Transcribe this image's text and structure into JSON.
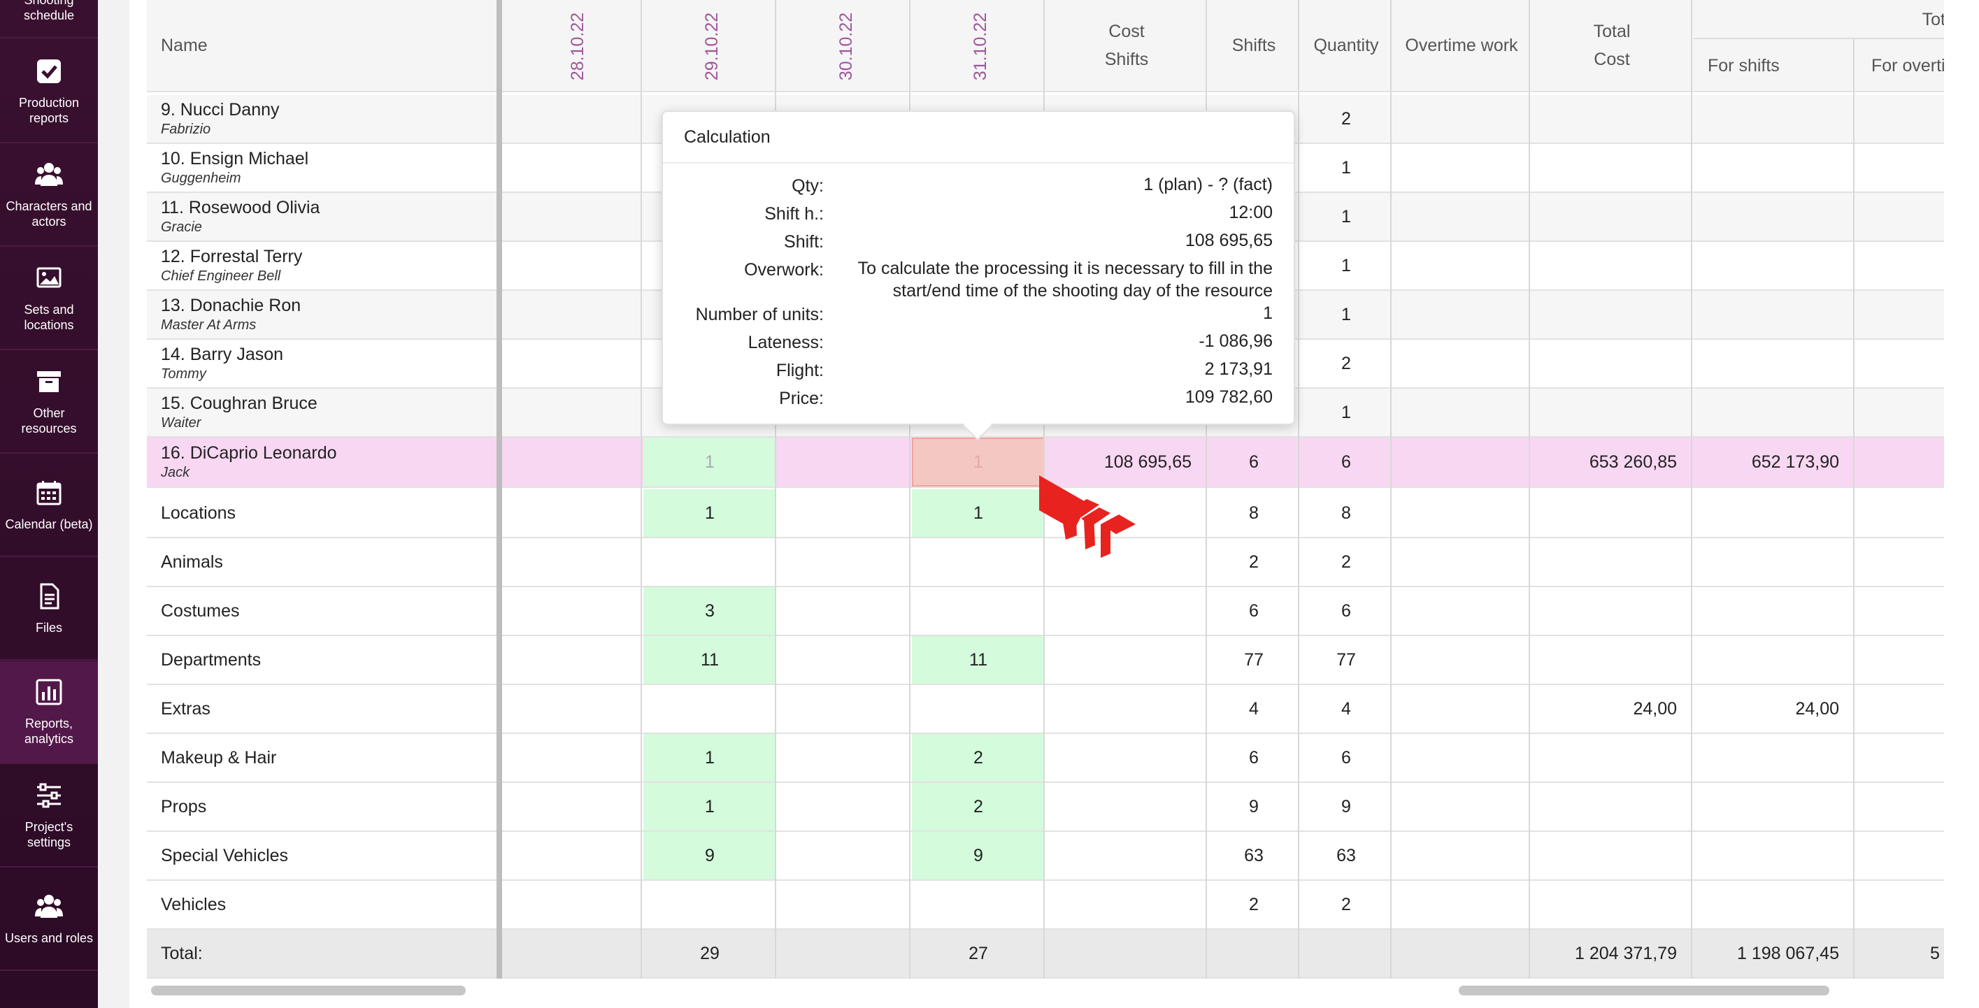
{
  "sidebar": {
    "items": [
      {
        "label": "Shooting schedule",
        "icon": "calendar-clock-icon"
      },
      {
        "label": "Production reports",
        "icon": "checkbox-icon"
      },
      {
        "label": "Characters and actors",
        "icon": "people-icon"
      },
      {
        "label": "Sets and locations",
        "icon": "image-icon"
      },
      {
        "label": "Other resources",
        "icon": "archive-box-icon"
      },
      {
        "label": "Calendar (beta)",
        "icon": "calendar-icon"
      },
      {
        "label": "Files",
        "icon": "file-icon"
      },
      {
        "label": "Reports, analytics",
        "icon": "bar-chart-icon"
      },
      {
        "label": "Project's settings",
        "icon": "sliders-icon"
      },
      {
        "label": "Users and roles",
        "icon": "users-icon"
      }
    ]
  },
  "table": {
    "headers": {
      "name": "Name",
      "dates": [
        "28.10.22",
        "29.10.22",
        "30.10.22",
        "31.10.22"
      ],
      "cost_line1": "Cost",
      "cost_line2": "Shifts",
      "shifts": "Shifts",
      "quantity": "Quantity",
      "overtime": "Overtime work",
      "total_cost_line1": "Total",
      "total_cost_line2": "Cost",
      "group_total": "Tot",
      "for_shifts": "For shifts",
      "for_overtime": "For overti"
    },
    "people": [
      {
        "name": "9. Nucci Danny",
        "role": "Fabrizio",
        "quantity": "2"
      },
      {
        "name": "10. Ensign Michael",
        "role": "Guggenheim",
        "quantity": "1"
      },
      {
        "name": "11. Rosewood Olivia",
        "role": "Gracie",
        "quantity": "1"
      },
      {
        "name": "12. Forrestal Terry",
        "role": "Chief Engineer Bell",
        "quantity": "1"
      },
      {
        "name": "13. Donachie Ron",
        "role": "Master At Arms",
        "quantity": "1"
      },
      {
        "name": "14. Barry Jason",
        "role": "Tommy",
        "quantity": "2"
      },
      {
        "name": "15. Coughran Bruce",
        "role": "Waiter",
        "quantity": "1"
      }
    ],
    "highlighted": {
      "name": "16. DiCaprio Leonardo",
      "role": "Jack",
      "d29": "1",
      "d31": "1",
      "cost": "108 695,65",
      "shifts": "6",
      "quantity": "6",
      "total": "653 260,85",
      "for_shifts": "652 173,90"
    },
    "categories": [
      {
        "name": "Locations",
        "d29": "1",
        "d31": "1",
        "shifts": "8",
        "quantity": "8",
        "total": "",
        "for_shifts": ""
      },
      {
        "name": "Animals",
        "d29": "",
        "d31": "",
        "shifts": "2",
        "quantity": "2",
        "total": "",
        "for_shifts": ""
      },
      {
        "name": "Costumes",
        "d29": "3",
        "d31": "",
        "shifts": "6",
        "quantity": "6",
        "total": "",
        "for_shifts": ""
      },
      {
        "name": "Departments",
        "d29": "11",
        "d31": "11",
        "shifts": "77",
        "quantity": "77",
        "total": "",
        "for_shifts": ""
      },
      {
        "name": "Extras",
        "d29": "",
        "d31": "",
        "shifts": "4",
        "quantity": "4",
        "total": "24,00",
        "for_shifts": "24,00"
      },
      {
        "name": "Makeup & Hair",
        "d29": "1",
        "d31": "2",
        "shifts": "6",
        "quantity": "6",
        "total": "",
        "for_shifts": ""
      },
      {
        "name": "Props",
        "d29": "1",
        "d31": "2",
        "shifts": "9",
        "quantity": "9",
        "total": "",
        "for_shifts": ""
      },
      {
        "name": "Special Vehicles",
        "d29": "9",
        "d31": "9",
        "shifts": "63",
        "quantity": "63",
        "total": "",
        "for_shifts": ""
      },
      {
        "name": "Vehicles",
        "d29": "",
        "d31": "",
        "shifts": "2",
        "quantity": "2",
        "total": "",
        "for_shifts": ""
      }
    ],
    "total_row": {
      "label": "Total:",
      "d29": "29",
      "d31": "27",
      "total": "1 204 371,79",
      "for_shifts": "1 198 067,45",
      "for_overtime": "5"
    }
  },
  "popup": {
    "title": "Calculation",
    "rows": [
      {
        "key": "Qty:",
        "value": "1 (plan) - ? (fact)"
      },
      {
        "key": "Shift h.:",
        "value": "12:00"
      },
      {
        "key": "Shift:",
        "value": "108 695,65"
      },
      {
        "key": "Overwork:",
        "value": "To calculate the processing it is necessary to fill in the start/end time of the shooting day of the resource"
      },
      {
        "key": "Number of units:",
        "value": "1"
      },
      {
        "key": "Lateness:",
        "value": "-1 086,96"
      },
      {
        "key": "Flight:",
        "value": "2 173,91"
      },
      {
        "key": "Price:",
        "value": "109 782,60"
      }
    ]
  },
  "colors": {
    "sidebar": "#2c0b26",
    "highlight_row": "#f8d7f3",
    "green_cell": "#d3fbdc",
    "date_text": "#a0559b",
    "cursor": "#e8221f"
  }
}
